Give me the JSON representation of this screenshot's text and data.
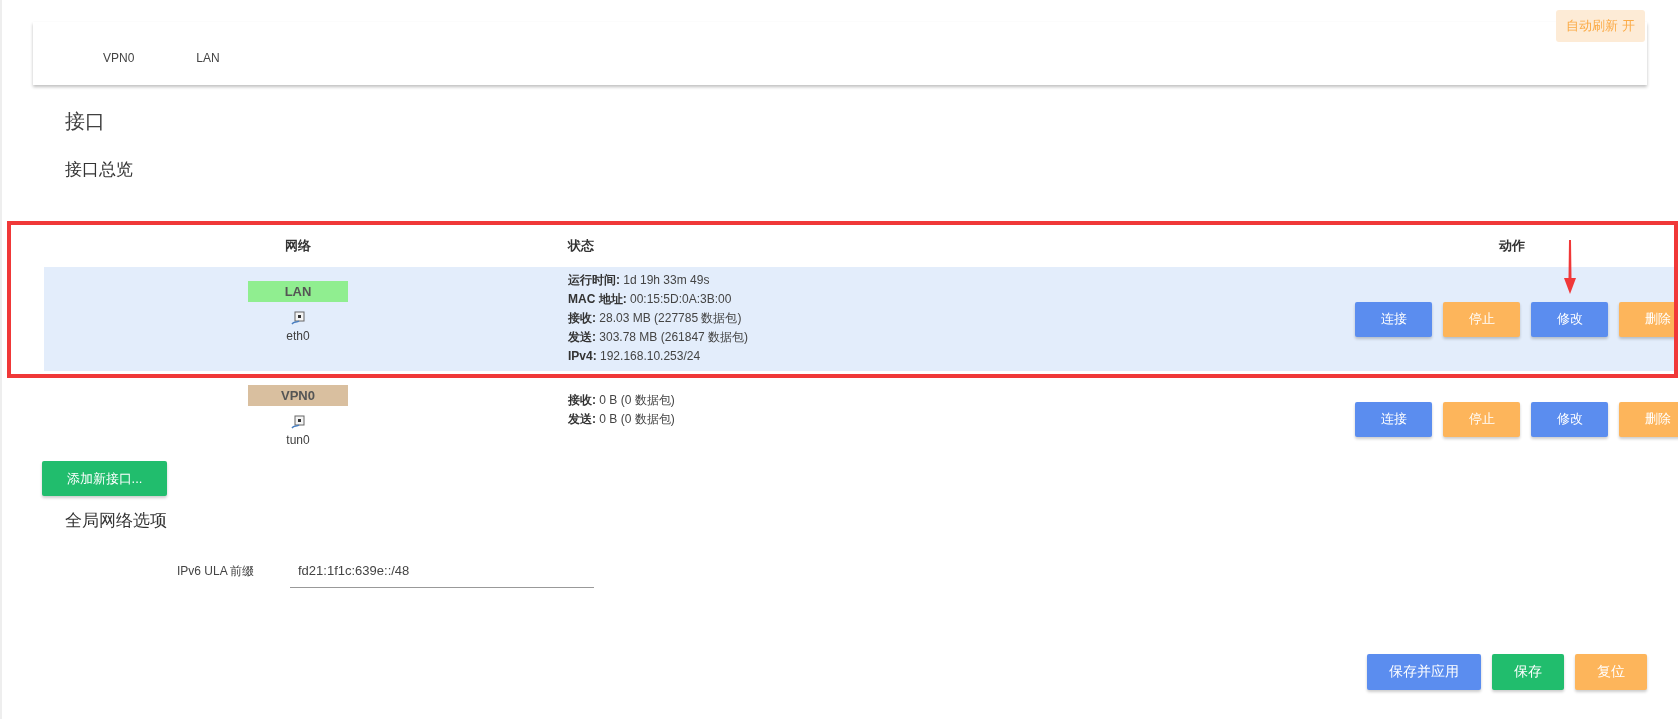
{
  "auto_refresh": {
    "label": "自动刷新 开",
    "on": true
  },
  "tabs": [
    {
      "label": "VPN0",
      "selected": false
    },
    {
      "label": "LAN",
      "selected": false
    }
  ],
  "title": "接口",
  "section_title": "接口总览",
  "table": {
    "columns": [
      "网络",
      "状态",
      "动作"
    ],
    "rows": [
      {
        "selected": true,
        "network": {
          "name": "LAN",
          "color": "#90ee90",
          "device": "eth0"
        },
        "status": [
          "**运行时间:** 1d 19h 33m 49s",
          "**MAC 地址:** 00:15:5D:0A:3B:00",
          "**接收:** 28.03 MB (227785 数据包)",
          "**发送:** 303.78 MB (261847 数据包)",
          "**IPv4:** 192.168.10.253/24"
        ],
        "actions": [
          {
            "label": "连接",
            "kind": "primary"
          },
          {
            "label": "停止",
            "kind": "warning"
          },
          {
            "label": "修改",
            "kind": "primary"
          },
          {
            "label": "删除",
            "kind": "warning"
          }
        ]
      },
      {
        "selected": false,
        "network": {
          "name": "VPN0",
          "color": "#d9bf9f",
          "device": "tun0"
        },
        "status": [
          "**接收:** 0 B (0 数据包)",
          "**发送:** 0 B (0 数据包)"
        ],
        "actions": [
          {
            "label": "连接",
            "kind": "primary"
          },
          {
            "label": "停止",
            "kind": "warning"
          },
          {
            "label": "修改",
            "kind": "primary"
          },
          {
            "label": "删除",
            "kind": "warning"
          }
        ]
      }
    ]
  },
  "add_button": "添加新接口...",
  "global_title": "全局网络选项",
  "ipv6_ula": {
    "label": "IPv6 ULA 前缀",
    "value": "fd21:1f1c:639e::/48"
  },
  "footer_buttons": [
    {
      "label": "保存并应用",
      "kind": "primary"
    },
    {
      "label": "保存",
      "kind": "success"
    },
    {
      "label": "复位",
      "kind": "warning"
    }
  ]
}
